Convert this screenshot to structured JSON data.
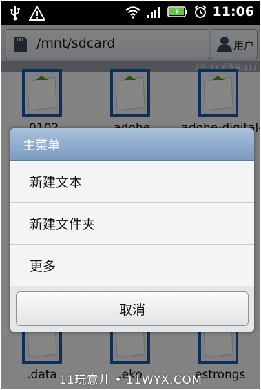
{
  "status_bar": {
    "icons": [
      "usb-icon",
      "alert-icon",
      "wifi-icon",
      "signal-icon",
      "battery-icon",
      "alarm-icon"
    ],
    "time": "11:06"
  },
  "toolbar": {
    "path": "/mnt/sdcard",
    "user_label": "用户",
    "count_text": "文件:13  文件夹:113"
  },
  "files": [
    {
      "name": ".0102"
    },
    {
      "name": ".adobe"
    },
    {
      "name": ".adobe-digital-"
    },
    {
      "name": ".data"
    },
    {
      "name": ".eko"
    },
    {
      "name": ".estrongs"
    }
  ],
  "dialog": {
    "title": "主菜单",
    "items": [
      {
        "label": "新建文本"
      },
      {
        "label": "新建文件夹"
      },
      {
        "label": "更多"
      }
    ],
    "cancel_label": "取消"
  },
  "watermark": "11玩意儿 • 11WYX.COM",
  "colors": {
    "dialog_title": "#8eabcc",
    "scrim": "rgba(0,0,0,0.48)"
  }
}
